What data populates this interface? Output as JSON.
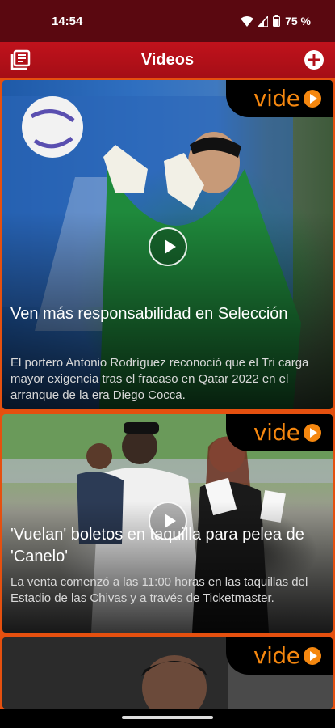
{
  "status_bar": {
    "time": "14:54",
    "battery": "75 %"
  },
  "app_bar": {
    "title": "Videos",
    "library_icon": "library-icon",
    "add_icon": "add-circle-icon"
  },
  "badge_text": "vide",
  "cards": [
    {
      "title": "Ven más responsabilidad en Selección",
      "description": "El portero Antonio Rodríguez reconoció que el Tri carga mayor exigencia tras el fracaso en Qatar 2022 en el arranque de la era Diego Cocca."
    },
    {
      "title": "'Vuelan' boletos en taquilla para pelea de 'Canelo'",
      "description": "La venta comenzó a las 11:00 horas en las taquillas del Estadio de las Chivas y a través de Ticketmaster."
    }
  ],
  "colors": {
    "app_bar": "#b0101a",
    "status_bar": "#5a0810",
    "badge_orange": "#f5870f",
    "feed_border": "#e5500f"
  }
}
